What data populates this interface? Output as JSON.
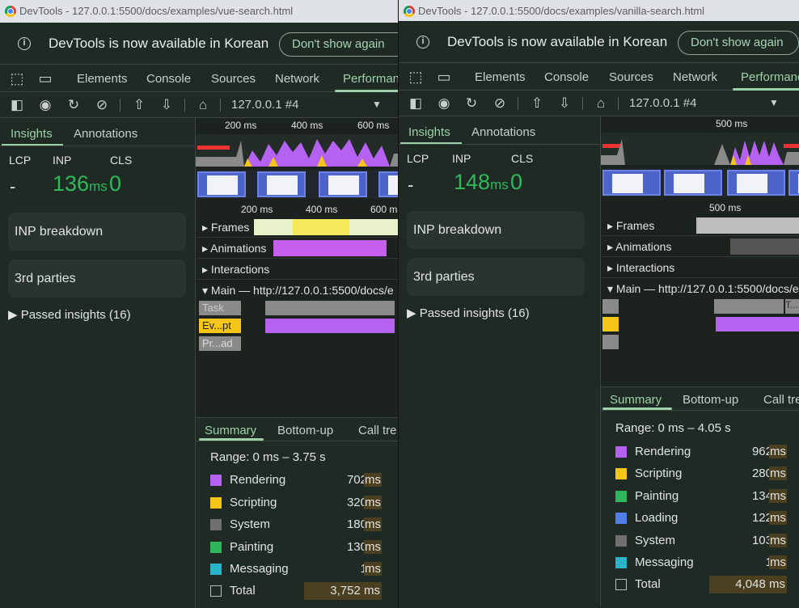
{
  "colors": {
    "accent": "#9ed1a9",
    "metric_good": "#2fb95b",
    "rendering": "#b561f2",
    "scripting": "#f5c518",
    "system": "#707070",
    "painting": "#2fb55a",
    "messaging": "#2bb3c9",
    "loading": "#4f7fe6"
  },
  "windows": [
    {
      "title": "DevTools - 127.0.0.1:5500/docs/examples/vue-search.html",
      "infobar": {
        "text": "DevTools is now available in Korean",
        "button": "Don't show again",
        "icon": "info-icon"
      },
      "tabs": [
        "Elements",
        "Console",
        "Sources",
        "Network",
        "Performance"
      ],
      "active_tab": "Performance",
      "toolbar": {
        "target": "127.0.0.1 #4"
      },
      "sidebar": {
        "tabs": [
          "Insights",
          "Annotations"
        ],
        "metrics": {
          "lcp_label": "LCP",
          "inp_label": "INP",
          "cls_label": "CLS",
          "lcp_value": "-",
          "inp_value": "136",
          "inp_unit": "ms",
          "cls_value": "0"
        },
        "cards": [
          "INP breakdown",
          "3rd parties"
        ],
        "passed": "Passed insights (16)"
      },
      "timeline": {
        "overview_ticks": [
          "200 ms",
          "400 ms",
          "600 ms"
        ],
        "ruler_ticks": [
          "200 ms",
          "400 ms",
          "600 ms"
        ],
        "tracks": [
          "Frames",
          "Animations",
          "Interactions"
        ],
        "main_track": "Main — http://127.0.0.1:5500/docs/e",
        "main_labels": [
          "Task",
          "Ev...pt",
          "Pr...ad"
        ]
      },
      "bottom": {
        "tabs": [
          "Summary",
          "Bottom-up",
          "Call tre"
        ],
        "range": "Range: 0 ms – 3.75 s",
        "rows": [
          {
            "label": "Rendering",
            "value": "702",
            "unit": "ms",
            "color": "#b561f2"
          },
          {
            "label": "Scripting",
            "value": "320",
            "unit": "ms",
            "color": "#f5c518"
          },
          {
            "label": "System",
            "value": "180",
            "unit": "ms",
            "color": "#707070"
          },
          {
            "label": "Painting",
            "value": "130",
            "unit": "ms",
            "color": "#2fb55a"
          },
          {
            "label": "Messaging",
            "value": "1",
            "unit": "ms",
            "color": "#2bb3c9"
          }
        ],
        "total_label": "Total",
        "total_value": "3,752 ms"
      }
    },
    {
      "title": "DevTools - 127.0.0.1:5500/docs/examples/vanilla-search.html",
      "infobar": {
        "text": "DevTools is now available in Korean",
        "button": "Don't show again",
        "icon": "info-icon"
      },
      "tabs": [
        "Elements",
        "Console",
        "Sources",
        "Network",
        "Performance"
      ],
      "active_tab": "Performance",
      "toolbar": {
        "target": "127.0.0.1 #4"
      },
      "sidebar": {
        "tabs": [
          "Insights",
          "Annotations"
        ],
        "metrics": {
          "lcp_label": "LCP",
          "inp_label": "INP",
          "cls_label": "CLS",
          "lcp_value": "-",
          "inp_value": "148",
          "inp_unit": "ms",
          "cls_value": "0"
        },
        "cards": [
          "INP breakdown",
          "3rd parties"
        ],
        "passed": "Passed insights (16)"
      },
      "timeline": {
        "overview_ticks": [
          "500 ms"
        ],
        "ruler_ticks": [
          "500 ms"
        ],
        "tracks": [
          "Frames",
          "Animations",
          "Interactions"
        ],
        "main_track": "Main — http://127.0.0.1:5500/docs/e",
        "main_labels": [
          "T..."
        ]
      },
      "bottom": {
        "tabs": [
          "Summary",
          "Bottom-up",
          "Call tre"
        ],
        "range": "Range: 0 ms – 4.05 s",
        "rows": [
          {
            "label": "Rendering",
            "value": "962",
            "unit": "ms",
            "color": "#b561f2"
          },
          {
            "label": "Scripting",
            "value": "280",
            "unit": "ms",
            "color": "#f5c518"
          },
          {
            "label": "Painting",
            "value": "134",
            "unit": "ms",
            "color": "#2fb55a"
          },
          {
            "label": "Loading",
            "value": "122",
            "unit": "ms",
            "color": "#4f7fe6"
          },
          {
            "label": "System",
            "value": "103",
            "unit": "ms",
            "color": "#707070"
          },
          {
            "label": "Messaging",
            "value": "1",
            "unit": "ms",
            "color": "#2bb3c9"
          }
        ],
        "total_label": "Total",
        "total_value": "4,048 ms"
      }
    }
  ]
}
